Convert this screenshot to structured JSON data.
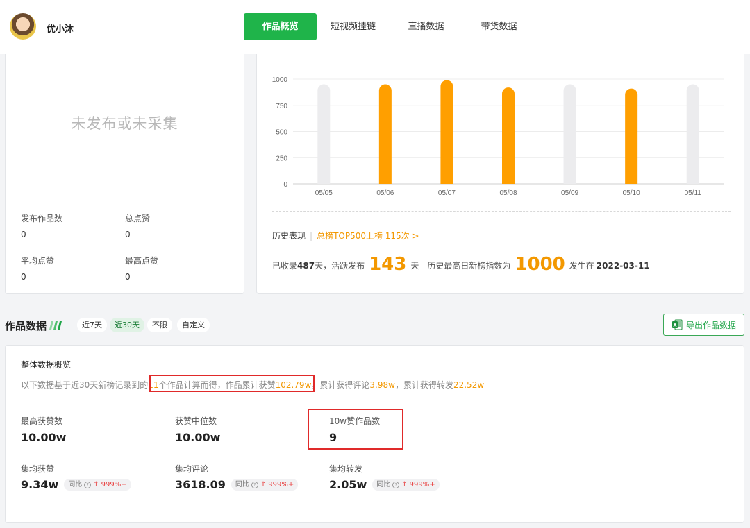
{
  "header": {
    "username": "优小沐",
    "tabs": [
      {
        "label": "作品概览",
        "active": true
      },
      {
        "label": "短视频挂链",
        "active": false
      },
      {
        "label": "直播数据",
        "active": false
      },
      {
        "label": "带货数据",
        "active": false
      }
    ]
  },
  "left_panel": {
    "empty_message": "未发布或未采集",
    "stats": [
      {
        "label": "发布作品数",
        "value": "0"
      },
      {
        "label": "总点赞",
        "value": "0"
      },
      {
        "label": "平均点赞",
        "value": "0"
      },
      {
        "label": "最高点赞",
        "value": "0"
      }
    ]
  },
  "chart_data": {
    "type": "bar",
    "categories": [
      "05/05",
      "05/06",
      "05/07",
      "05/08",
      "05/09",
      "05/10",
      "05/11"
    ],
    "values": [
      null,
      950,
      990,
      920,
      null,
      910,
      null
    ],
    "y_ticks": [
      "1000",
      "750",
      "500",
      "250",
      "0"
    ],
    "ylim": [
      0,
      1000
    ],
    "grid": true,
    "bar_color": "#ff9f00",
    "empty_bar_color": "#ececee"
  },
  "history": {
    "label": "历史表现",
    "link": "总榜TOP500上榜 115次 >",
    "recorded_prefix": "已收录",
    "recorded_days": "487",
    "recorded_suffix": "天，活跃发布",
    "active_days": "143",
    "days_unit": "天",
    "max_index_label": "历史最高日新榜指数为",
    "max_index": "1000",
    "date_prefix": "发生在",
    "date": "2022-03-11"
  },
  "works_section": {
    "title": "作品数据",
    "filters": [
      {
        "label": "近7天",
        "active": false
      },
      {
        "label": "近30天",
        "active": true
      },
      {
        "label": "不限",
        "active": false
      },
      {
        "label": "自定义",
        "active": false
      }
    ],
    "export_label": "导出作品数据"
  },
  "overview": {
    "title": "整体数据概览",
    "summary_p1": "以下数据基于近30天新榜记录到的",
    "summary_count": "11",
    "summary_p2": "个作品计算而得，作品累计获赞",
    "summary_likes": "102.79w",
    "summary_p3": "，累计获得评论",
    "summary_comments": "3.98w",
    "summary_p4": "，累计获得转发",
    "summary_shares": "22.52w",
    "metrics_top": [
      {
        "label": "最高获赞数",
        "value": "10.00w"
      },
      {
        "label": "获赞中位数",
        "value": "10.00w"
      },
      {
        "label": "10w赞作品数",
        "value": "9"
      }
    ],
    "metrics_bottom": [
      {
        "label": "集均获赞",
        "value": "9.34w",
        "yoy_label": "同比",
        "yoy_value": "999%+"
      },
      {
        "label": "集均评论",
        "value": "3618.09",
        "yoy_label": "同比",
        "yoy_value": "999%+"
      },
      {
        "label": "集均转发",
        "value": "2.05w",
        "yoy_label": "同比",
        "yoy_value": "999%+"
      }
    ]
  }
}
